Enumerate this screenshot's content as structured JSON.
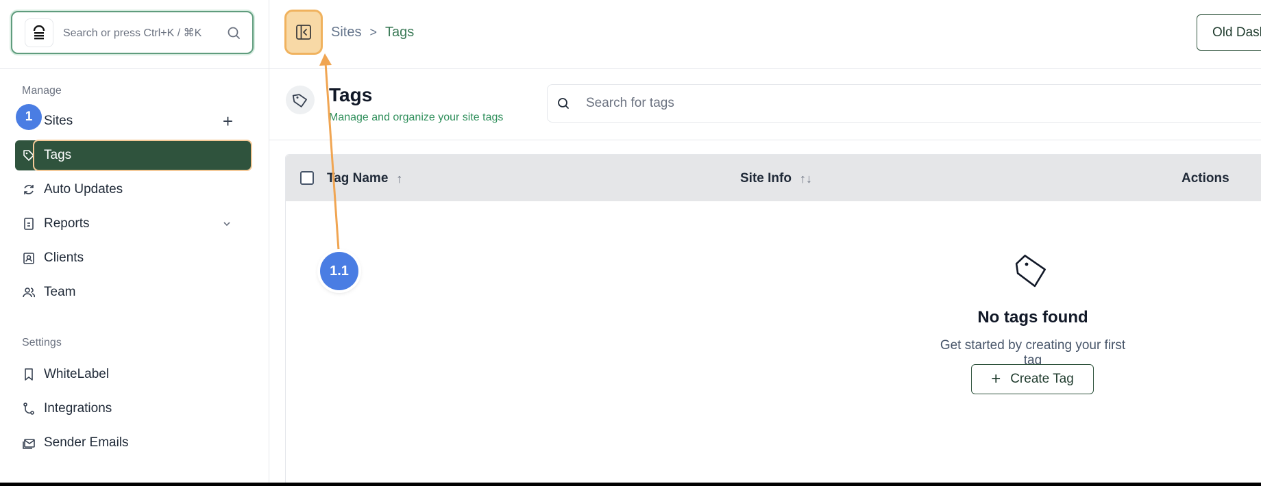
{
  "sidebar": {
    "search_placeholder": "Search or press Ctrl+K / ⌘K",
    "manage_title": "Manage",
    "settings_title": "Settings",
    "manage_items": [
      {
        "label": "Sites",
        "icon": "globe-icon"
      },
      {
        "label": "Tags",
        "icon": "tag-icon"
      },
      {
        "label": "Auto Updates",
        "icon": "refresh-icon"
      },
      {
        "label": "Reports",
        "icon": "report-icon"
      },
      {
        "label": "Clients",
        "icon": "client-icon"
      },
      {
        "label": "Team",
        "icon": "users-icon"
      }
    ],
    "settings_items": [
      {
        "label": "WhiteLabel",
        "icon": "bookmark-icon"
      },
      {
        "label": "Integrations",
        "icon": "git-icon"
      },
      {
        "label": "Sender Emails",
        "icon": "mail-icon"
      }
    ],
    "add_symbol": "+"
  },
  "header": {
    "breadcrumb": [
      "Sites",
      "Tags"
    ],
    "breadcrumb_sep": ">",
    "old_dashboard_label": "Old Dashboard"
  },
  "page": {
    "title": "Tags",
    "subtitle": "Manage and organize your site tags",
    "search_placeholder": "Search for tags"
  },
  "table": {
    "columns": [
      "Tag Name",
      "Site Info",
      "Actions"
    ],
    "sort_asc": "↑",
    "sort_both": "↑↓"
  },
  "empty_state": {
    "title": "No tags found",
    "subtitle": "Get started by creating your first tag",
    "button_label": "Create Tag",
    "button_symbol": "+"
  },
  "annotations": {
    "step1": "1",
    "step11": "1.1"
  },
  "colors": {
    "brand_green": "#2f533d",
    "accent_green": "#3b7a57",
    "highlight_orange": "#f0b25e",
    "badge_blue": "#4a7de3"
  }
}
